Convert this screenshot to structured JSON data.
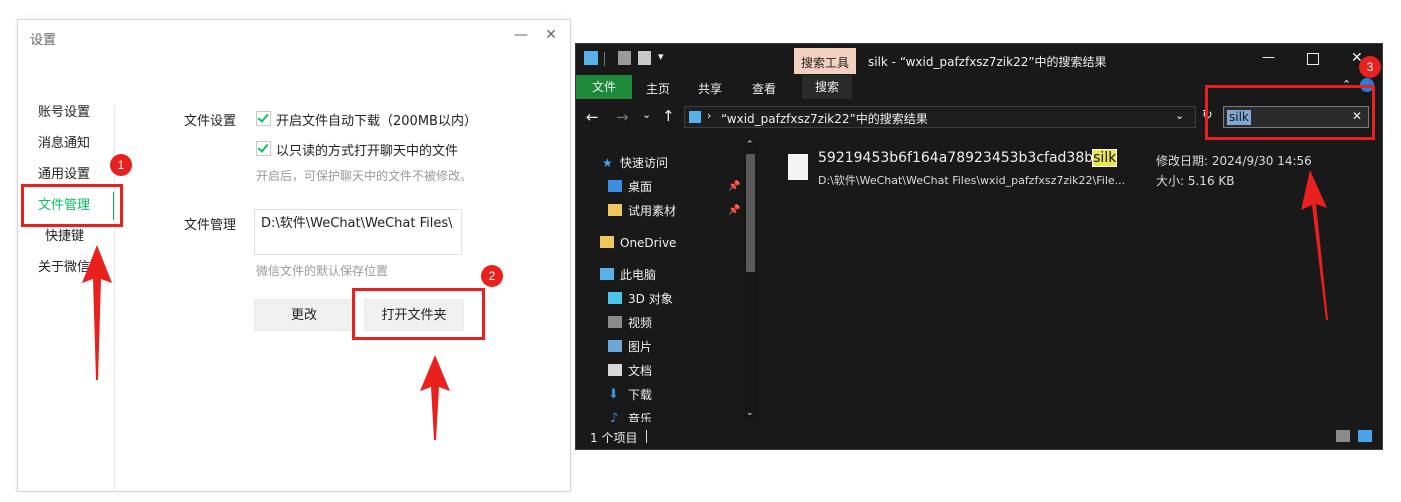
{
  "wechat": {
    "window_title": "设置",
    "minimize": "—",
    "close": "✕",
    "nav": [
      "账号设置",
      "消息通知",
      "通用设置",
      "文件管理",
      "快捷键",
      "关于微信"
    ],
    "file_settings": {
      "label": "文件设置",
      "auto_download": "开启文件自动下载（200MB以内）",
      "readonly_open": "以只读的方式打开聊天中的文件",
      "readonly_hint": "开启后，可保护聊天中的文件不被修改。"
    },
    "file_management": {
      "label": "文件管理",
      "path": "D:\\软件\\WeChat\\WeChat Files\\",
      "path_hint": "微信文件的默认保存位置",
      "change_button": "更改",
      "open_folder_button": "打开文件夹"
    }
  },
  "annotations": {
    "badge1": "1",
    "badge2": "2",
    "badge3": "3",
    "color": "#e8201e"
  },
  "explorer": {
    "context_tab": "搜索工具",
    "window_title": "silk - “wxid_pafzfxsz7zik22”中的搜索结果",
    "ribbon_tabs": [
      "文件",
      "主页",
      "共享",
      "查看",
      "搜索"
    ],
    "address": "“wxid_pafzfxsz7zik22”中的搜索结果",
    "search_value": "silk",
    "tree": [
      {
        "label": "快速访问",
        "icon": "star-icon"
      },
      {
        "label": "桌面",
        "icon": "desktop-icon"
      },
      {
        "label": "试用素材",
        "icon": "folder-icon"
      },
      {
        "label": "OneDrive",
        "icon": "folder-icon"
      },
      {
        "label": "此电脑",
        "icon": "pc-icon"
      },
      {
        "label": "3D 对象",
        "icon": "cube-icon"
      },
      {
        "label": "视频",
        "icon": "video-icon"
      },
      {
        "label": "图片",
        "icon": "picture-icon"
      },
      {
        "label": "文档",
        "icon": "document-icon"
      },
      {
        "label": "下载",
        "icon": "download-icon"
      },
      {
        "label": "音乐",
        "icon": "music-icon"
      }
    ],
    "result": {
      "name": "59219453b6f164a78923453b3cfad38b",
      "ext": "silk",
      "path": "D:\\软件\\WeChat\\WeChat Files\\wxid_pafzfxsz7zik22\\File...",
      "modified_label": "修改日期: 2024/9/30 14:56",
      "size_label": "大小: 5.16 KB"
    },
    "status": "1 个项目"
  }
}
